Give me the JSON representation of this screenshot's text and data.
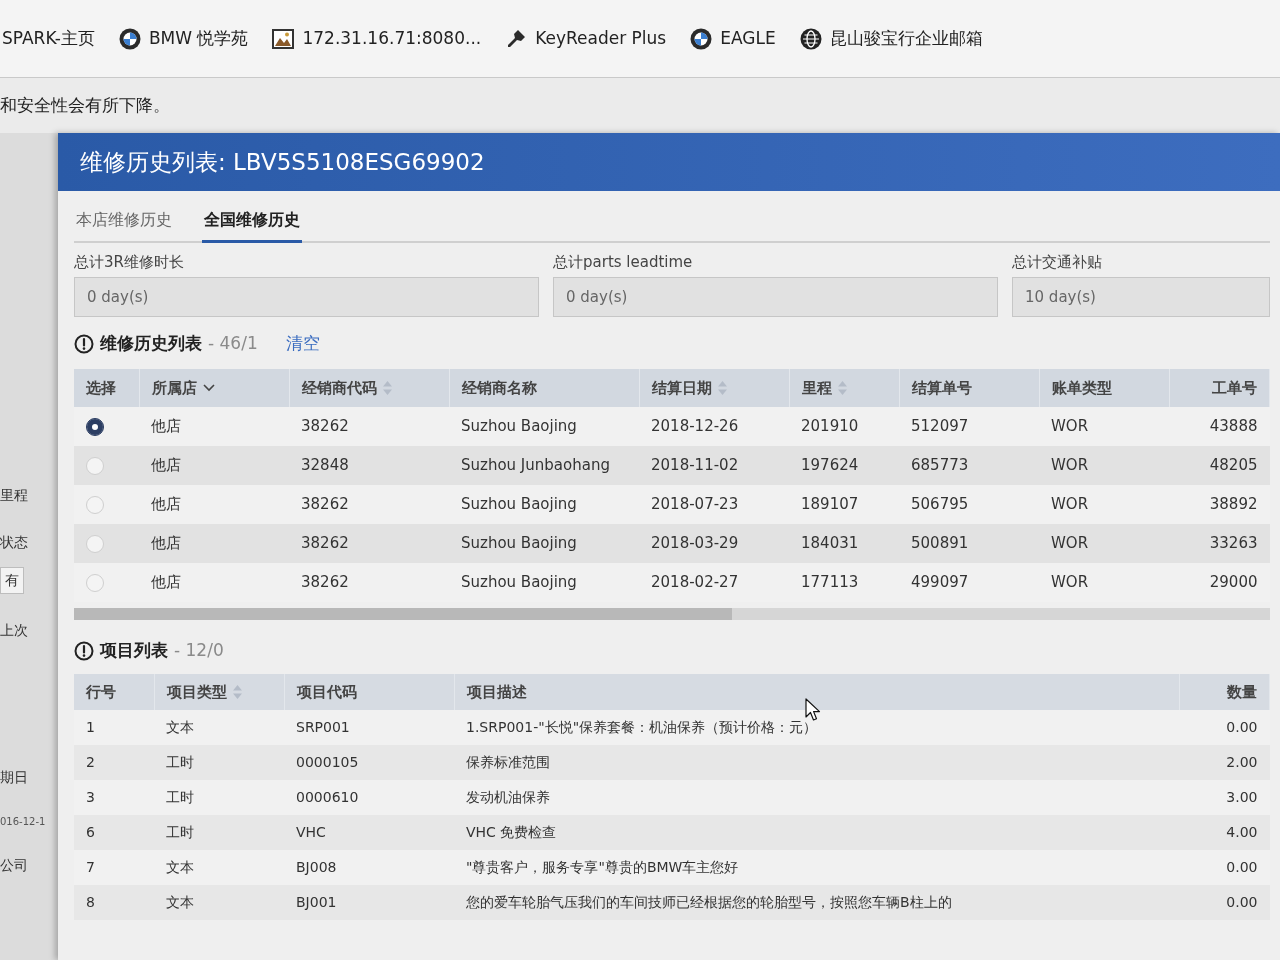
{
  "bookmarks": [
    {
      "label": "SPARK-主页",
      "kind": "plain"
    },
    {
      "label": "BMW 悦学苑",
      "kind": "roundel"
    },
    {
      "label": "172.31.16.71:8080...",
      "kind": "picture"
    },
    {
      "label": "KeyReader Plus",
      "kind": "key"
    },
    {
      "label": "EAGLE",
      "kind": "roundel"
    },
    {
      "label": "昆山骏宝行企业邮箱",
      "kind": "globe"
    }
  ],
  "page_notice": "和安全性会有所下降。",
  "background_page": [
    {
      "text": "里程",
      "kind": "label"
    },
    {
      "text": "状态",
      "kind": "label"
    },
    {
      "text": "有",
      "kind": "field"
    },
    {
      "text": "上次",
      "kind": "label"
    },
    {
      "text": "期日",
      "kind": "label"
    },
    {
      "text": "016-12-1",
      "kind": "value"
    },
    {
      "text": "公司",
      "kind": "label"
    }
  ],
  "dialog": {
    "title": "维修历史列表: LBV5S5108ESG69902",
    "tabs": [
      {
        "label": "本店维修历史",
        "selected": false
      },
      {
        "label": "全国维修历史",
        "selected": true
      }
    ],
    "totals": [
      {
        "label": "总计3R维修时长",
        "value": "0 day(s)"
      },
      {
        "label": "总计parts leadtime",
        "value": "0 day(s)"
      },
      {
        "label": "总计交通补贴",
        "value": "10 day(s)"
      }
    ],
    "history": {
      "title": "维修历史列表",
      "count": "- 46/1",
      "clear_link": "清空",
      "select_column": "选择",
      "columns": [
        {
          "label": "所属店",
          "kind": "dropdown"
        },
        {
          "label": "经销商代码",
          "kind": "sortable"
        },
        {
          "label": "经销商名称",
          "kind": "plain"
        },
        {
          "label": "结算日期",
          "kind": "sortable"
        },
        {
          "label": "里程",
          "kind": "sortable"
        },
        {
          "label": "结算单号",
          "kind": "plain"
        },
        {
          "label": "账单类型",
          "kind": "plain"
        },
        {
          "label": "工单号",
          "kind": "plain"
        }
      ],
      "rows": [
        {
          "selected": true,
          "cells": [
            "他店",
            "38262",
            "Suzhou Baojing",
            "2018-12-26",
            "201910",
            "512097",
            "WOR",
            "43888"
          ]
        },
        {
          "selected": false,
          "cells": [
            "他店",
            "32848",
            "Suzhou Junbaohang",
            "2018-11-02",
            "197624",
            "685773",
            "WOR",
            "48205"
          ]
        },
        {
          "selected": false,
          "cells": [
            "他店",
            "38262",
            "Suzhou Baojing",
            "2018-07-23",
            "189107",
            "506795",
            "WOR",
            "38892"
          ]
        },
        {
          "selected": false,
          "cells": [
            "他店",
            "38262",
            "Suzhou Baojing",
            "2018-03-29",
            "184031",
            "500891",
            "WOR",
            "33263"
          ]
        },
        {
          "selected": false,
          "cells": [
            "他店",
            "38262",
            "Suzhou Baojing",
            "2018-02-27",
            "177113",
            "499097",
            "WOR",
            "29000"
          ]
        }
      ]
    },
    "items": {
      "title": "项目列表",
      "count": "- 12/0",
      "columns": [
        {
          "label": "行号",
          "kind": "plain"
        },
        {
          "label": "项目类型",
          "kind": "sortable"
        },
        {
          "label": "项目代码",
          "kind": "plain"
        },
        {
          "label": "项目描述",
          "kind": "plain"
        },
        {
          "label": "数量",
          "kind": "plain"
        }
      ],
      "rows": [
        [
          "1",
          "文本",
          "SRP001",
          "1.SRP001-\"长悦\"保养套餐：机油保养（预计价格：元）",
          "0.00"
        ],
        [
          "2",
          "工时",
          "0000105",
          "保养标准范围",
          "2.00"
        ],
        [
          "3",
          "工时",
          "0000610",
          "发动机油保养",
          "3.00"
        ],
        [
          "6",
          "工时",
          "VHC",
          "VHC 免费检查",
          "4.00"
        ],
        [
          "7",
          "文本",
          "BJ008",
          "\"尊贵客户，服务专享\"尊贵的BMW车主您好",
          "0.00"
        ],
        [
          "8",
          "文本",
          "BJ001",
          "您的爱车轮胎气压我们的车间技师已经根据您的轮胎型号，按照您车辆B柱上的",
          "0.00"
        ]
      ]
    }
  }
}
